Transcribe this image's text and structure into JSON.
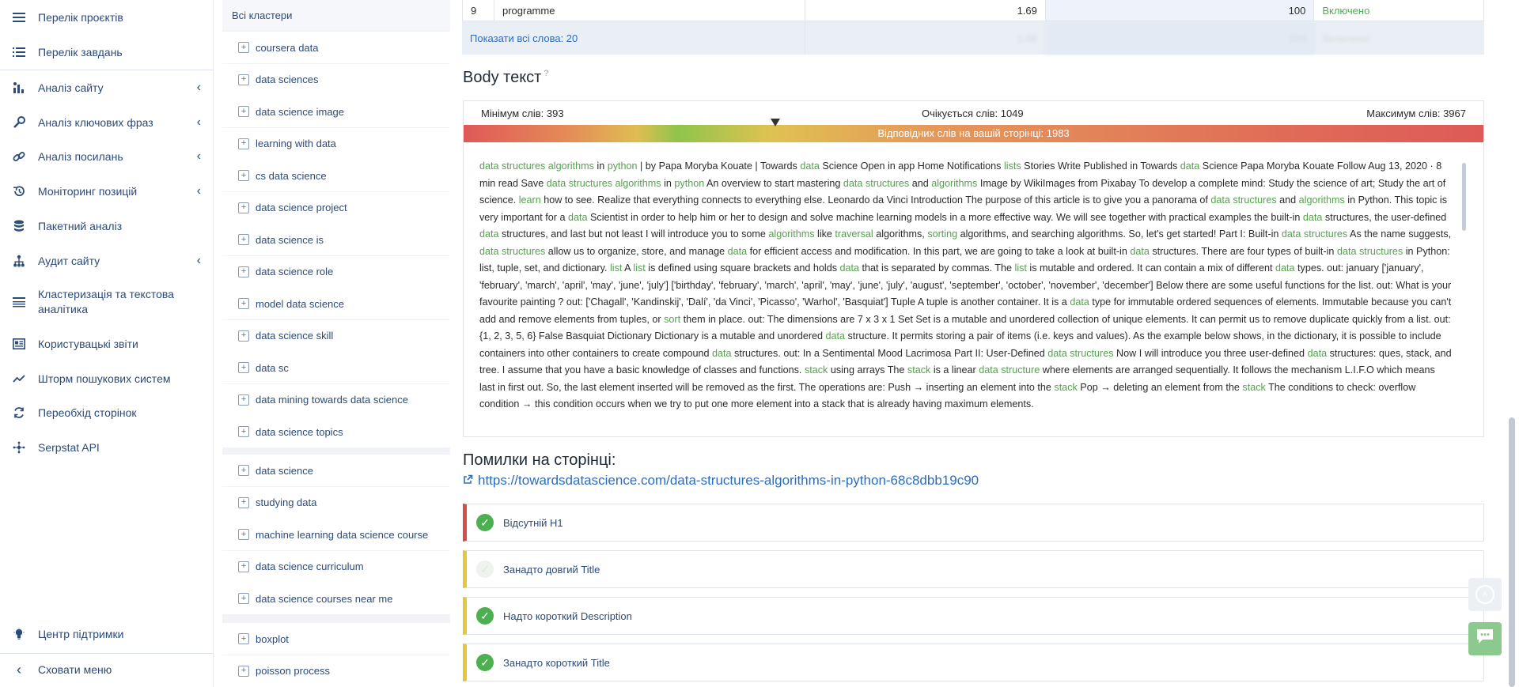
{
  "sidebar": {
    "items": [
      {
        "label": "Перелік проєктів",
        "icon": "menu-icon"
      },
      {
        "label": "Перелік завдань",
        "icon": "list-icon"
      },
      {
        "label": "Аналіз сайту",
        "icon": "bar-chart-icon"
      },
      {
        "label": "Аналіз ключових фраз",
        "icon": "key-icon"
      },
      {
        "label": "Аналіз посилань",
        "icon": "link-icon"
      },
      {
        "label": "Моніторинг позицій",
        "icon": "history-icon"
      },
      {
        "label": "Пакетний аналіз",
        "icon": "database-icon"
      },
      {
        "label": "Аудит сайту",
        "icon": "sitemap-icon"
      },
      {
        "label": "Кластеризація та текстова аналітика",
        "icon": "cluster-icon"
      },
      {
        "label": "Користувацькі звіти",
        "icon": "report-icon"
      },
      {
        "label": "Шторм пошукових систем",
        "icon": "trend-icon"
      },
      {
        "label": "Переобхід сторінок",
        "icon": "refresh-icon"
      },
      {
        "label": "Serpstat API",
        "icon": "api-icon"
      }
    ],
    "support": "Центр підтримки",
    "hide_menu": "Сховати меню"
  },
  "clusters": {
    "title": "Всі кластери",
    "groups": [
      [
        "coursera data",
        "data sciences",
        "data science image",
        "learning with data",
        "cs data science",
        "data science project",
        "data science is",
        "data science role",
        "model data science",
        "data science skill",
        "data sc",
        "data mining towards data science",
        "data science topics"
      ],
      [
        "data science",
        "studying data",
        "machine learning data science course",
        "data science curriculum",
        "data science courses near me"
      ],
      [
        "boxplot",
        "poisson process"
      ]
    ]
  },
  "table": {
    "row": {
      "num": "9",
      "word": "programme",
      "score": "1.69",
      "count": "100",
      "status": "Включено"
    },
    "show_all": "Показати всі слова: 20",
    "blur_values": [
      "1.68",
      "100",
      "Включено"
    ]
  },
  "body_text": {
    "title": "Body текст",
    "hint": "?",
    "min_words": "Мінімум слів: 393",
    "expected_words": "Очікується слів: 1049",
    "max_words": "Максимум слів: 3967",
    "relevant_words": "Відповідних слів на вашій сторінці: 1983",
    "marker_fraction": 0.306,
    "content_html": "<span class=\"kw\">data structures algorithms</span> in <span class=\"kw\">python</span> | by Papa Moryba Kouate | Towards <span class=\"kw\">data</span> Science Open in app Home Notifications <span class=\"kw\">lists</span> Stories Write Published in Towards <span class=\"kw\">data</span> Science Papa Moryba Kouate Follow Aug 13, 2020 · 8 min read Save <span class=\"kw\">data structures algorithms</span> in <span class=\"kw\">python</span> An overview to start mastering <span class=\"kw\">data structures</span> and <span class=\"kw\">algorithms</span> Image by WikiImages from Pixabay To develop a complete mind: Study the science of art; Study the art of science. <span class=\"kw\">learn</span> how to see. Realize that everything connects to everything else. Leonardo da Vinci Introduction The purpose of this article is to give you a panorama of <span class=\"kw\">data structures</span> and <span class=\"kw\">algorithms</span> in Python. This topic is very important for a <span class=\"kw\">data</span> Scientist in order to help him or her to design and solve machine learning models in a more effective way. We will see together with practical examples the built-in <span class=\"kw\">data</span> structures, the user-defined <span class=\"kw\">data</span> structures, and last but not least I will introduce you to some <span class=\"kw\">algorithms</span> like <span class=\"kw\">traversal</span> algorithms, <span class=\"kw\">sorting</span> algorithms, and searching algorithms. So, let's get started! Part I: Built-in <span class=\"kw\">data structures</span> As the name suggests, <span class=\"kw\">data structures</span> allow us to organize, store, and manage <span class=\"kw\">data</span> for efficient access and modification. In this part, we are going to take a look at built-in <span class=\"kw\">data</span> structures. There are four types of built-in <span class=\"kw\">data structures</span> in Python: list, tuple, set, and dictionary. <span class=\"kw\">list</span> A <span class=\"kw\">list</span> is defined using square brackets and holds <span class=\"kw\">data</span> that is separated by commas. The <span class=\"kw\">list</span> is mutable and ordered. It can contain a mix of different <span class=\"kw\">data</span> types. out: january ['january', 'february', 'march', 'april', 'may', 'june', 'july'] ['birthday', 'february', 'march', 'april', 'may', 'june', 'july', 'august', 'september', 'october', 'november', 'december'] Below there are some useful functions for the list. out: What is your favourite painting ? out: ['Chagall', 'Kandinskij', 'Dalí', 'da Vinci', 'Picasso', 'Warhol', 'Basquiat'] Tuple A tuple is another container. It is a <span class=\"kw\">data</span> type for immutable ordered sequences of elements. Immutable because you can't add and remove elements from tuples, or <span class=\"kw\">sort</span> them in place. out: The dimensions are 7 x 3 x 1 Set Set is a mutable and unordered collection of unique elements. It can permit us to remove duplicate quickly from a list. out: {1, 2, 3, 5, 6} False Basquiat Dictionary Dictionary is a mutable and unordered <span class=\"kw\">data</span> structure. It permits storing a pair of items (i.e. keys and values). As the example below shows, in the dictionary, it is possible to include containers into other containers to create compound <span class=\"kw\">data</span> structures. out: In a Sentimental Mood Lacrimosa Part II: User-Defined <span class=\"kw\">data structures</span> Now I will introduce you three user-defined <span class=\"kw\">data</span> structures: ques, stack, and tree. I assume that you have a basic knowledge of classes and functions. <span class=\"kw\">stack</span> using arrays The <span class=\"kw\">stack</span> is a linear <span class=\"kw\">data structure</span> where elements are arranged sequentially. It follows the mechanism L.I.F.O which means last in first out. So, the last element inserted will be removed as the first. The operations are: Push → inserting an element into the <span class=\"kw\">stack</span> Pop → deleting an element from the <span class=\"kw\">stack</span> The conditions to check: overflow condition → this condition occurs when we try to put one more element into a stack that is already having maximum elements."
  },
  "errors": {
    "title": "Помилки на сторінці:",
    "url": "https://towardsdatascience.com/data-structures-algorithms-in-python-68c8dbb19c90",
    "items": [
      {
        "label": "Відсутній H1",
        "accent": "#d84b4b"
      },
      {
        "label": "Занадто довгий Title",
        "accent": "#e2c83c"
      },
      {
        "label": "Надто короткий Description",
        "accent": "#e2c83c"
      },
      {
        "label": "Занадто короткий Title",
        "accent": "#e2c83c"
      }
    ]
  },
  "colors": {
    "accent": "#2c4b78",
    "keyword": "#54a24d",
    "error_red": "#d84b4b",
    "warn_yellow": "#e2c83c",
    "ok_green": "#4caf50"
  }
}
